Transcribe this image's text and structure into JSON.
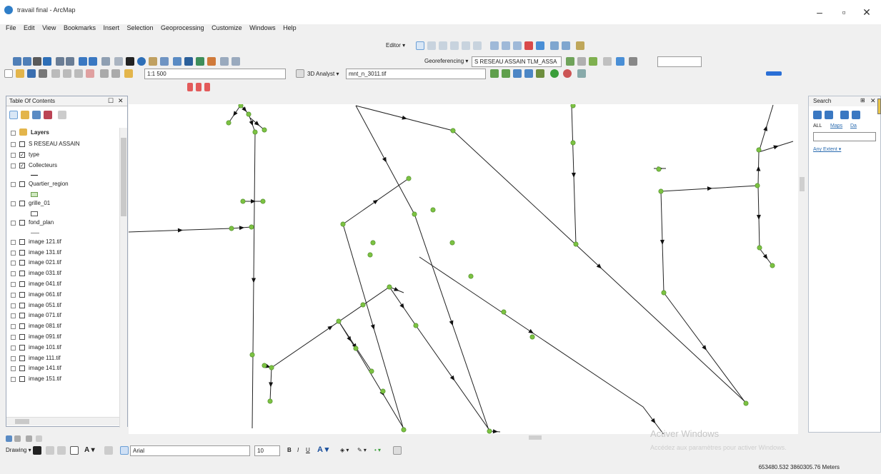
{
  "window": {
    "title": "travail final - ArcMap",
    "minimize": "–",
    "maximize": "▫",
    "close": "✕"
  },
  "menu": [
    "File",
    "Edit",
    "View",
    "Bookmarks",
    "Insert",
    "Selection",
    "Geoprocessing",
    "Customize",
    "Windows",
    "Help"
  ],
  "toolbar": {
    "editor_label": "Editor ▾",
    "georef_label": "Georeferencing ▾",
    "georef_layer": "S RESEAU ASSAIN TLM_ASSA",
    "scale": "1:1 500",
    "analyst_label": "3D Analyst ▾",
    "raster_layer": "mnt_n_3011.tif",
    "font_name": "Arial",
    "font_size": "10"
  },
  "toc": {
    "title": "Table Of Contents",
    "layers_label": "Layers",
    "items": [
      {
        "label": "S RESEAU ASSAIN",
        "checked": false
      },
      {
        "label": "type",
        "checked": true
      },
      {
        "label": "Collecteurs",
        "checked": true
      },
      {
        "label": "Quartier_region",
        "checked": false
      },
      {
        "label": "grille_01",
        "checked": false
      },
      {
        "label": "fond_plan",
        "checked": false
      },
      {
        "label": "image 121.tif",
        "checked": false
      },
      {
        "label": "image 131.tif",
        "checked": false
      },
      {
        "label": "image 021.tif",
        "checked": false
      },
      {
        "label": "image 031.tif",
        "checked": false
      },
      {
        "label": "image 041.tif",
        "checked": false
      },
      {
        "label": "image 061.tif",
        "checked": false
      },
      {
        "label": "image 051.tif",
        "checked": false
      },
      {
        "label": "image 071.tif",
        "checked": false
      },
      {
        "label": "image 081.tif",
        "checked": false
      },
      {
        "label": "image 091.tif",
        "checked": false
      },
      {
        "label": "image 101.tif",
        "checked": false
      },
      {
        "label": "image 111.tif",
        "checked": false
      },
      {
        "label": "image 141.tif",
        "checked": false
      },
      {
        "label": "image 151.tif",
        "checked": false
      }
    ]
  },
  "search": {
    "title": "Search",
    "tabs": [
      "ALL",
      "Maps",
      "Da"
    ],
    "any_extent": "Any Extent ▾"
  },
  "drawing": {
    "label": "Drawing ▾"
  },
  "watermark": {
    "line1": "Activer Windows",
    "line2": "Accédez aux paramètres pour activer Windows."
  },
  "status": {
    "coordinates": "653480.532  3860305.76 Meters"
  },
  "colors": {
    "node": "#7cc242",
    "line": "#222222",
    "toc_border": "#9ca7b8"
  }
}
